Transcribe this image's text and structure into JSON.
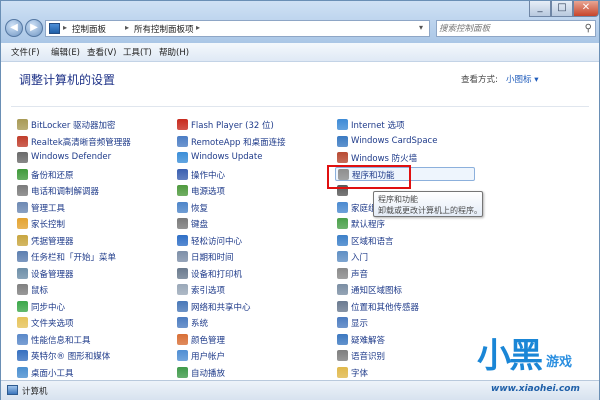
{
  "window": {
    "breadcrumb": [
      "控制面板",
      "所有控制面板项"
    ],
    "search_placeholder": "搜索控制面板"
  },
  "menu": [
    "文件(F)",
    "编辑(E)",
    "查看(V)",
    "工具(T)",
    "帮助(H)"
  ],
  "header": {
    "title": "调整计算机的设置",
    "view_by_label": "查看方式:",
    "view_by_value": "小图标 ▾"
  },
  "columns": [
    [
      {
        "label": "BitLocker 驱动器加密",
        "color": "#a89a55"
      },
      {
        "label": "Realtek高清晰音频管理器",
        "color": "#c03d2b"
      },
      {
        "label": "Windows Defender",
        "color": "#6a6a6a"
      },
      {
        "label": "备份和还原",
        "color": "#3f9a3a"
      },
      {
        "label": "电话和调制解调器",
        "color": "#7b7b7b"
      },
      {
        "label": "管理工具",
        "color": "#6d89b3"
      },
      {
        "label": "家长控制",
        "color": "#e4a330"
      },
      {
        "label": "凭据管理器",
        "color": "#c8a640"
      },
      {
        "label": "任务栏和「开始」菜单",
        "color": "#5d7fb0"
      },
      {
        "label": "设备管理器",
        "color": "#6e8fa8"
      },
      {
        "label": "鼠标",
        "color": "#808080"
      },
      {
        "label": "同步中心",
        "color": "#3ca84a"
      },
      {
        "label": "文件夹选项",
        "color": "#e6c35a"
      },
      {
        "label": "性能信息和工具",
        "color": "#5a88c8"
      },
      {
        "label": "英特尔® 图形和媒体",
        "color": "#3670c0"
      },
      {
        "label": "桌面小工具",
        "color": "#4a8fd0"
      }
    ],
    [
      {
        "label": "Flash Player (32 位)",
        "color": "#c72a1e"
      },
      {
        "label": "RemoteApp 和桌面连接",
        "color": "#4b7dc4"
      },
      {
        "label": "Windows Update",
        "color": "#3b8ed8"
      },
      {
        "label": "操作中心",
        "color": "#3a5fb0"
      },
      {
        "label": "电源选项",
        "color": "#4f9a3e"
      },
      {
        "label": "恢复",
        "color": "#4d85c8"
      },
      {
        "label": "键盘",
        "color": "#7a7a7a"
      },
      {
        "label": "轻松访问中心",
        "color": "#2f6fc6"
      },
      {
        "label": "日期和时间",
        "color": "#7d8fa8"
      },
      {
        "label": "设备和打印机",
        "color": "#6b7b8e"
      },
      {
        "label": "索引选项",
        "color": "#9aa8b8"
      },
      {
        "label": "网络和共享中心",
        "color": "#4978b8"
      },
      {
        "label": "系统",
        "color": "#4c7cc0"
      },
      {
        "label": "颜色管理",
        "color": "#d86f36"
      },
      {
        "label": "用户帐户",
        "color": "#4f8ed3"
      },
      {
        "label": "自动播放",
        "color": "#3f9a4a"
      }
    ],
    [
      {
        "label": "Internet 选项",
        "color": "#3e8bd6"
      },
      {
        "label": "Windows CardSpace",
        "color": "#3a7ac2"
      },
      {
        "label": "Windows 防火墙",
        "color": "#b84a32"
      },
      {
        "label": "程序和功能",
        "color": "#8e8e8e"
      },
      {
        "label": "",
        "color": "#5a5a5a"
      },
      {
        "label": "家庭组",
        "color": "#4b8ad0"
      },
      {
        "label": "默认程序",
        "color": "#4aa04a"
      },
      {
        "label": "区域和语言",
        "color": "#3d80c8"
      },
      {
        "label": "入门",
        "color": "#5f8fc4"
      },
      {
        "label": "声音",
        "color": "#8a8a8a"
      },
      {
        "label": "通知区域图标",
        "color": "#7b8ea3"
      },
      {
        "label": "位置和其他传感器",
        "color": "#6a7a90"
      },
      {
        "label": "显示",
        "color": "#4c7cc0"
      },
      {
        "label": "疑难解答",
        "color": "#3c78c0"
      },
      {
        "label": "语音识别",
        "color": "#7e7e7e"
      },
      {
        "label": "字体",
        "color": "#e0b84a"
      }
    ]
  ],
  "tooltip": {
    "title": "程序和功能",
    "description": "卸载或更改计算机上的程序。"
  },
  "status": {
    "text": "计算机"
  },
  "watermark": {
    "logo": "小黑",
    "game": "游戏",
    "url": "www.xiaohei.com"
  }
}
